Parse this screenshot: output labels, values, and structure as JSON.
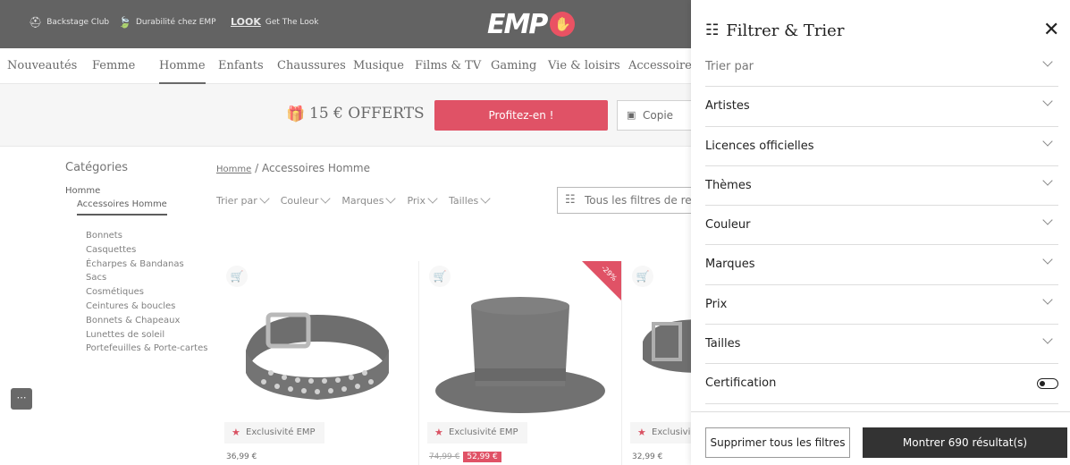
{
  "topbar": {
    "links": [
      "Backstage Club",
      "Durabilité chez EMP",
      "Get The Look"
    ],
    "logo": "EMP",
    "logo_mark": "✋"
  },
  "nav": {
    "items": [
      "Nouveautés",
      "Femme",
      "Homme",
      "Enfants",
      "Chaussures",
      "Musique",
      "Films & TV",
      "Gaming",
      "Vie & loisirs",
      "Accessoires"
    ],
    "active": "Homme"
  },
  "promo": {
    "text": "15 € OFFERTS",
    "button": "Profitez-en !",
    "copy_button": "Copie"
  },
  "sidebar": {
    "title": "Catégories",
    "parent": "Homme",
    "active": "Accessoires Homme",
    "items": [
      "Bonnets",
      "Casquettes",
      "Écharpes & Bandanas",
      "Sacs",
      "Cosmétiques",
      "Ceintures & boucles",
      "Bonnets & Chapeaux",
      "Lunettes de soleil",
      "Portefeuilles & Porte-cartes"
    ]
  },
  "listing": {
    "breadcrumb_link": "Homme",
    "breadcrumb_current": " / Accessoires Homme",
    "filters": [
      "Trier par",
      "Couleur",
      "Marques",
      "Prix",
      "Tailles"
    ],
    "all_filters": "Tous les filtres de re"
  },
  "products": [
    {
      "badge": "Exclusivité EMP",
      "price": "36,99 €"
    },
    {
      "badge": "Exclusivité EMP",
      "old_price": "74,99 €",
      "price": "52,99 €",
      "discount": "-29%"
    },
    {
      "badge": "Exclusivi",
      "price": "32,99 €"
    }
  ],
  "panel": {
    "title": "Filtrer & Trier",
    "close": "✕",
    "rows": [
      {
        "label": "Trier par",
        "muted": true
      },
      {
        "label": "Artistes"
      },
      {
        "label": "Licences officielles"
      },
      {
        "label": "Thèmes"
      },
      {
        "label": "Couleur"
      },
      {
        "label": "Marques"
      },
      {
        "label": "Prix"
      },
      {
        "label": "Tailles"
      }
    ],
    "certification": "Certification",
    "certification_on": false,
    "clear_button": "Supprimer tous les filtres",
    "show_button": "Montrer 690 résultat(s)"
  },
  "colors": {
    "accent": "#d2001e",
    "dark": "#1a1a1a",
    "button_dark": "#333333"
  }
}
